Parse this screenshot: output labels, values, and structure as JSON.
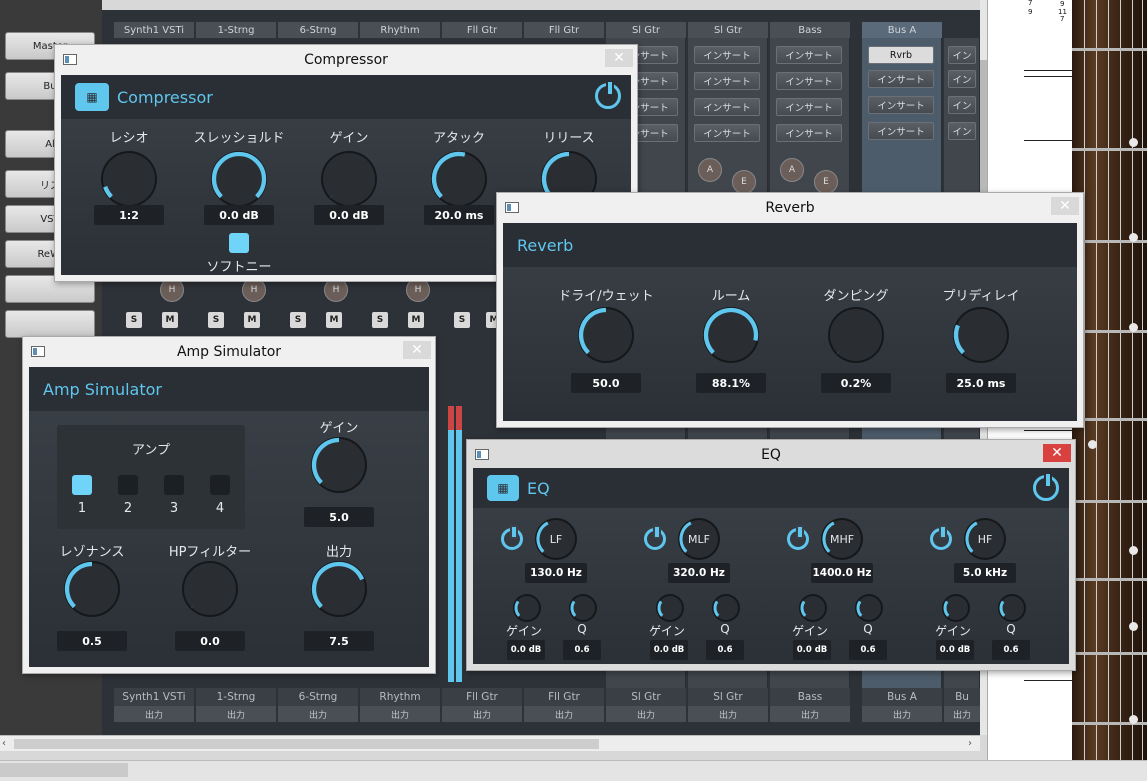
{
  "sidebar": {
    "items": [
      "Master",
      "Bu",
      "",
      "Al",
      "リス",
      "VST",
      "ReWi",
      "",
      ""
    ]
  },
  "console": {
    "channels": [
      "Synth1 VSTi",
      "1-Strng",
      "6-Strng",
      "Rhythm",
      "Fll Gtr",
      "Fll Gtr",
      "Sl Gtr",
      "Sl Gtr",
      "Bass"
    ],
    "bus": "Bus A",
    "bus_short": "Bu",
    "output_label": "出力",
    "insert_label": "インサート",
    "insert_short": "イン",
    "bus_plugin": "Rvrb",
    "solo": "S",
    "mute": "M",
    "send_a": "A",
    "send_e": "E",
    "h_button": "H"
  },
  "score": {
    "numbers": [
      "7",
      "9",
      "9",
      "11",
      "7"
    ]
  },
  "compressor": {
    "window_title": "Compressor",
    "panel_title": "Compressor",
    "knobs": [
      {
        "label": "レシオ",
        "value": "1:2",
        "level": 0.1
      },
      {
        "label": "スレッショルド",
        "value": "0.0 dB",
        "level": 1.0
      },
      {
        "label": "ゲイン",
        "value": "0.0 dB",
        "level": 0.0
      },
      {
        "label": "アタック",
        "value": "20.0 ms",
        "level": 0.55
      },
      {
        "label": "リリース",
        "value": "",
        "level": 0.5
      }
    ],
    "softknee_label": "ソフトニー"
  },
  "reverb": {
    "window_title": "Reverb",
    "panel_title": "Reverb",
    "knobs": [
      {
        "label": "ドライ/ウェット",
        "value": "50.0",
        "level": 0.5
      },
      {
        "label": "ルーム",
        "value": "88.1%",
        "level": 0.88
      },
      {
        "label": "ダンピング",
        "value": "0.2%",
        "level": 0.0
      },
      {
        "label": "プリディレイ",
        "value": "25.0 ms",
        "level": 0.25
      }
    ]
  },
  "amp": {
    "window_title": "Amp Simulator",
    "panel_title": "Amp Simulator",
    "amp_label": "アンプ",
    "amp_buttons": [
      "1",
      "2",
      "3",
      "4"
    ],
    "gain": {
      "label": "ゲイン",
      "value": "5.0",
      "level": 0.5
    },
    "resonance": {
      "label": "レゾナンス",
      "value": "0.5",
      "level": 0.5
    },
    "hpfilter": {
      "label": "HPフィルター",
      "value": "0.0",
      "level": 0.0
    },
    "output": {
      "label": "出力",
      "value": "7.5",
      "level": 0.75
    }
  },
  "eq": {
    "window_title": "EQ",
    "panel_title": "EQ",
    "bands": [
      {
        "name": "LF",
        "freq": "130.0 Hz",
        "gain_label": "ゲイン",
        "gain": "0.0 dB",
        "q_label": "Q",
        "q": "0.6"
      },
      {
        "name": "MLF",
        "freq": "320.0 Hz",
        "gain_label": "ゲイン",
        "gain": "0.0 dB",
        "q_label": "Q",
        "q": "0.6"
      },
      {
        "name": "MHF",
        "freq": "1400.0 Hz",
        "gain_label": "ゲイン",
        "gain": "0.0 dB",
        "q_label": "Q",
        "q": "0.6"
      },
      {
        "name": "HF",
        "freq": "5.0 kHz",
        "gain_label": "ゲイン",
        "gain": "0.0 dB",
        "q_label": "Q",
        "q": "0.6"
      }
    ]
  },
  "colors": {
    "accent": "#5fc6ee",
    "panel": "#3b4148",
    "header": "#2a2f35",
    "close_red": "#d94040"
  }
}
